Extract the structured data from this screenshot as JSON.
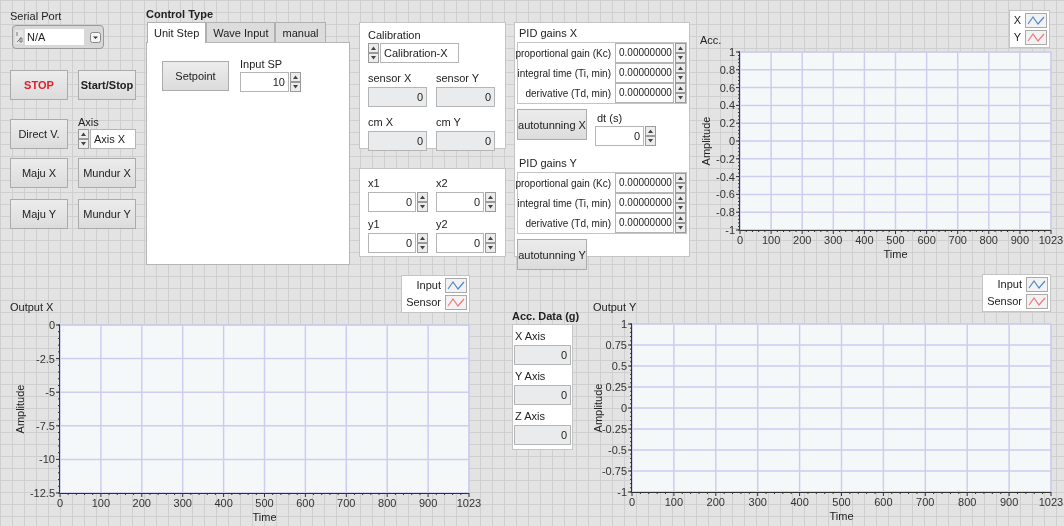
{
  "serial_port": {
    "label": "Serial Port",
    "value": "N/A"
  },
  "buttons": [
    {
      "label": "STOP",
      "kind": "alarm"
    },
    {
      "label": "Start/Stop",
      "kind": "strong"
    },
    {
      "label": "Direct V.",
      "kind": "plain"
    },
    {
      "label": "Maju X",
      "kind": "plain"
    },
    {
      "label": "Mundur X",
      "kind": "plain"
    },
    {
      "label": "Maju Y",
      "kind": "plain"
    },
    {
      "label": "Mundur Y",
      "kind": "plain"
    }
  ],
  "axis": {
    "label": "Axis",
    "value": "Axis X"
  },
  "control_type": {
    "label": "Control Type",
    "tabs": [
      {
        "label": "Unit Step",
        "selected": true
      },
      {
        "label": "Wave Input",
        "selected": false
      },
      {
        "label": "manual",
        "selected": false
      }
    ],
    "setpoint_button": "Setpoint",
    "input_sp": {
      "label": "Input SP",
      "value": "10"
    }
  },
  "calibration": {
    "label": "Calibration",
    "value": "Calibration-X",
    "indicators": [
      {
        "label": "sensor X",
        "value": "0"
      },
      {
        "label": "sensor Y",
        "value": "0"
      },
      {
        "label": "cm X",
        "value": "0"
      },
      {
        "label": "cm Y",
        "value": "0"
      }
    ]
  },
  "points": [
    {
      "label": "x1",
      "value": "0"
    },
    {
      "label": "x2",
      "value": "0"
    },
    {
      "label": "y1",
      "value": "0"
    },
    {
      "label": "y2",
      "value": "0"
    }
  ],
  "pid": {
    "gains": [
      {
        "title": "PID gains X",
        "rows": [
          {
            "label": "proportional gain (Kc)",
            "value": "0.00000000"
          },
          {
            "label": "integral time (Ti, min)",
            "value": "0.00000000"
          },
          {
            "label": "derivative (Td, min)",
            "value": "0.00000000"
          }
        ],
        "button": "autotunning X"
      },
      {
        "title": "PID gains Y",
        "rows": [
          {
            "label": "proportional gain (Kc)",
            "value": "0.00000000"
          },
          {
            "label": "integral time (Ti, min)",
            "value": "0.00000000"
          },
          {
            "label": "derivative (Td, min)",
            "value": "0.00000000"
          }
        ],
        "button": "autotunning Y"
      }
    ],
    "dt": {
      "label": "dt (s)",
      "value": "0"
    }
  },
  "acc_chart": {
    "chart_data": {
      "type": "line",
      "title": "Acc.",
      "xlabel": "Time",
      "ylabel": "Amplitude",
      "grid": true,
      "categories": [
        "0",
        "100",
        "200",
        "300",
        "400",
        "500",
        "600",
        "700",
        "800",
        "900",
        "1023"
      ],
      "ylim": [
        -1,
        1
      ],
      "yticks": [
        1,
        0.8,
        0.6,
        0.4,
        0.2,
        0,
        -0.2,
        -0.4,
        -0.6,
        -0.8,
        -1
      ],
      "series": [
        {
          "name": "X",
          "color": "#4f8ac9",
          "values": [
            null,
            null,
            null,
            null,
            null,
            null,
            null,
            null,
            null,
            null,
            null
          ]
        },
        {
          "name": "Y",
          "color": "#f0787a",
          "values": [
            null,
            null,
            null,
            null,
            null,
            null,
            null,
            null,
            null,
            null,
            null
          ]
        }
      ]
    }
  },
  "output_x": {
    "chart_data": {
      "type": "line",
      "title": "Output X",
      "xlabel": "Time",
      "ylabel": "Amplitude",
      "grid": true,
      "categories": [
        "0",
        "100",
        "200",
        "300",
        "400",
        "500",
        "600",
        "700",
        "800",
        "900",
        "1023"
      ],
      "ylim": [
        -12.5,
        0
      ],
      "yticks": [
        0,
        -2.5,
        -5,
        -7.5,
        -10,
        -12.5
      ],
      "series": [
        {
          "name": "Input",
          "color": "#4f8ac9",
          "values": [
            null,
            null,
            null,
            null,
            null,
            null,
            null,
            null,
            null,
            null,
            null
          ]
        },
        {
          "name": "Sensor",
          "color": "#f0787a",
          "values": [
            null,
            null,
            null,
            null,
            null,
            null,
            null,
            null,
            null,
            null,
            null
          ]
        }
      ]
    }
  },
  "acc_data": {
    "label": "Acc. Data (g)",
    "axes": [
      {
        "label": "X Axis",
        "value": "0"
      },
      {
        "label": "Y Axis",
        "value": "0"
      },
      {
        "label": "Z Axis",
        "value": "0"
      }
    ]
  },
  "output_y": {
    "chart_data": {
      "type": "line",
      "title": "Output Y",
      "xlabel": "Time",
      "ylabel": "Amplitude",
      "grid": true,
      "categories": [
        "0",
        "100",
        "200",
        "300",
        "400",
        "500",
        "600",
        "700",
        "800",
        "900",
        "1023"
      ],
      "ylim": [
        -1,
        1
      ],
      "yticks": [
        1,
        0.75,
        0.5,
        0.25,
        0,
        -0.25,
        -0.5,
        -0.75,
        -1
      ],
      "series": [
        {
          "name": "Input",
          "color": "#4f8ac9",
          "values": [
            null,
            null,
            null,
            null,
            null,
            null,
            null,
            null,
            null,
            null,
            null
          ]
        },
        {
          "name": "Sensor",
          "color": "#f0787a",
          "values": [
            null,
            null,
            null,
            null,
            null,
            null,
            null,
            null,
            null,
            null,
            null
          ]
        }
      ]
    }
  }
}
